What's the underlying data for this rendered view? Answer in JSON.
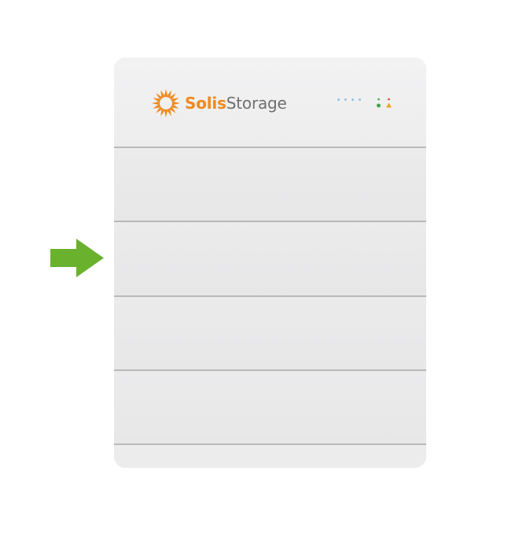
{
  "brand": {
    "name_part1": "Solis",
    "name_part2": "Storage"
  },
  "colors": {
    "brand_orange": "#ee8a1f",
    "brand_gray": "#6f6f72",
    "arrow_green": "#6ab22e",
    "indicator_blue": "#8fc3ea",
    "indicator_green": "#3aa33a",
    "indicator_red": "#d63a2c",
    "indicator_orange": "#f0a02a"
  },
  "icons": {
    "pointer": "right-arrow-icon",
    "logo": "sun-logo-icon",
    "run_status": "run-indicator-icon",
    "alarm_status": "alarm-indicator-icon"
  },
  "battery_modules": 4
}
